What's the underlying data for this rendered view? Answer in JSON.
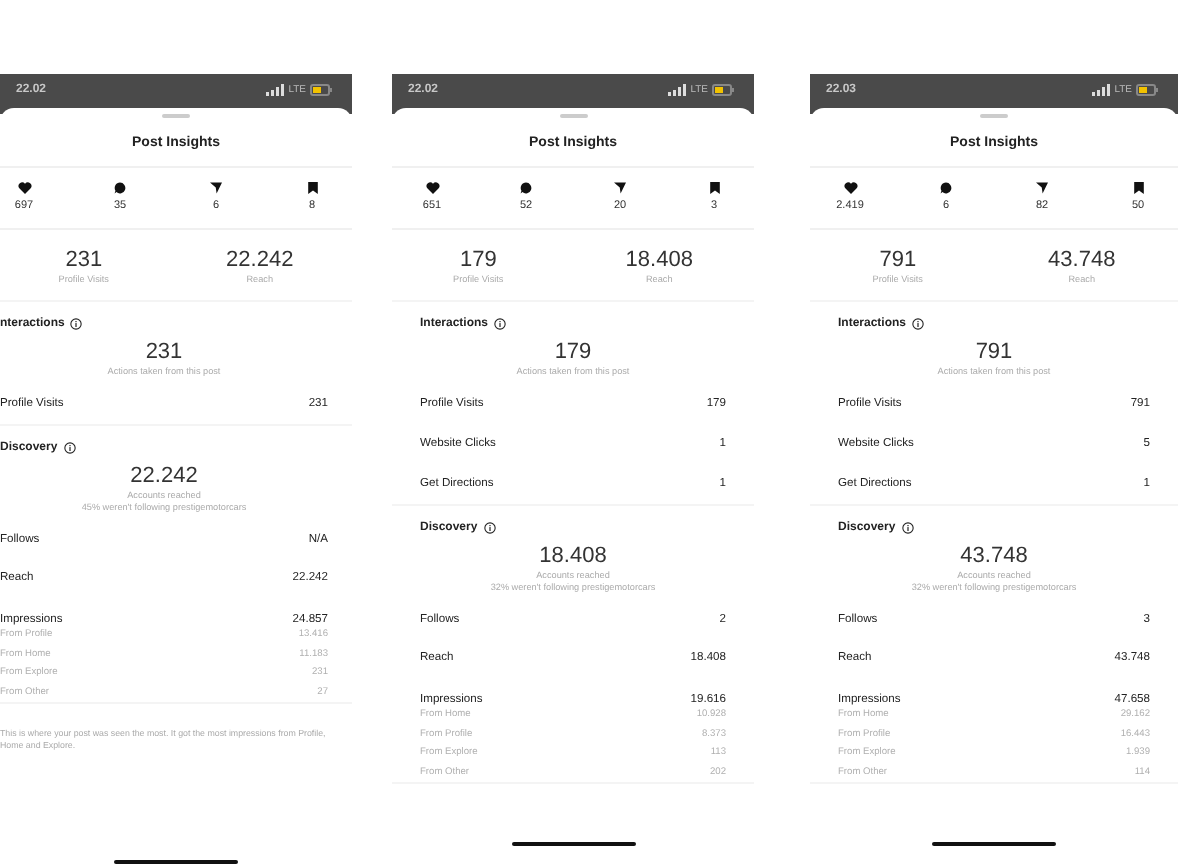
{
  "phones": [
    {
      "status": {
        "time": "22.02",
        "network": "LTE"
      },
      "title": "Post Insights",
      "stats": [
        {
          "kind": "likes",
          "value": "697"
        },
        {
          "kind": "comments",
          "value": "35"
        },
        {
          "kind": "shares",
          "value": "6"
        },
        {
          "kind": "saves",
          "value": "8"
        }
      ],
      "highlights": [
        {
          "value": "231",
          "label": "Profile Visits"
        },
        {
          "value": "22.242",
          "label": "Reach"
        }
      ],
      "interactions": {
        "heading": "nteractions",
        "total": "231",
        "caption": "Actions taken from this post",
        "rows": [
          {
            "label": "Profile Visits",
            "value": "231"
          }
        ]
      },
      "discovery": {
        "heading": "Discovery",
        "total": "22.242",
        "caption": "Accounts reached",
        "note": "45% weren't following prestigemotorcars",
        "rows": [
          {
            "kind": "main",
            "label": "Follows",
            "value": "N/A"
          },
          {
            "kind": "main",
            "label": "Reach",
            "value": "22.242"
          },
          {
            "kind": "main",
            "label": "Impressions",
            "value": "24.857"
          },
          {
            "kind": "sub",
            "label": "From Profile",
            "value": "13.416"
          },
          {
            "kind": "sub",
            "label": "From Home",
            "value": "11.183"
          },
          {
            "kind": "sub",
            "label": "From Explore",
            "value": "231"
          },
          {
            "kind": "sub",
            "label": "From Other",
            "value": "27"
          }
        ]
      },
      "footer": "This is where your post was seen the most. It got the most impressions from Profile, Home and Explore."
    },
    {
      "status": {
        "time": "22.02",
        "network": "LTE"
      },
      "title": "Post Insights",
      "stats": [
        {
          "kind": "likes",
          "value": "651"
        },
        {
          "kind": "comments",
          "value": "52"
        },
        {
          "kind": "shares",
          "value": "20"
        },
        {
          "kind": "saves",
          "value": "3"
        }
      ],
      "highlights": [
        {
          "value": "179",
          "label": "Profile Visits"
        },
        {
          "value": "18.408",
          "label": "Reach"
        }
      ],
      "interactions": {
        "heading": "Interactions",
        "total": "179",
        "caption": "Actions taken from this post",
        "rows": [
          {
            "label": "Profile Visits",
            "value": "179"
          },
          {
            "label": "Website Clicks",
            "value": "1"
          },
          {
            "label": "Get Directions",
            "value": "1"
          }
        ]
      },
      "discovery": {
        "heading": "Discovery",
        "total": "18.408",
        "caption": "Accounts reached",
        "note": "32% weren't following prestigemotorcars",
        "rows": [
          {
            "kind": "main",
            "label": "Follows",
            "value": "2"
          },
          {
            "kind": "main",
            "label": "Reach",
            "value": "18.408"
          },
          {
            "kind": "main",
            "label": "Impressions",
            "value": "19.616"
          },
          {
            "kind": "sub",
            "label": "From Home",
            "value": "10.928"
          },
          {
            "kind": "sub",
            "label": "From Profile",
            "value": "8.373"
          },
          {
            "kind": "sub",
            "label": "From Explore",
            "value": "113"
          },
          {
            "kind": "sub",
            "label": "From Other",
            "value": "202"
          }
        ]
      }
    },
    {
      "status": {
        "time": "22.03",
        "network": "LTE"
      },
      "title": "Post Insights",
      "stats": [
        {
          "kind": "likes",
          "value": "2.419"
        },
        {
          "kind": "comments",
          "value": "6"
        },
        {
          "kind": "shares",
          "value": "82"
        },
        {
          "kind": "saves",
          "value": "50"
        }
      ],
      "highlights": [
        {
          "value": "791",
          "label": "Profile Visits"
        },
        {
          "value": "43.748",
          "label": "Reach"
        }
      ],
      "interactions": {
        "heading": "Interactions",
        "total": "791",
        "caption": "Actions taken from this post",
        "rows": [
          {
            "label": "Profile Visits",
            "value": "791"
          },
          {
            "label": "Website Clicks",
            "value": "5"
          },
          {
            "label": "Get Directions",
            "value": "1"
          }
        ]
      },
      "discovery": {
        "heading": "Discovery",
        "total": "43.748",
        "caption": "Accounts reached",
        "note": "32% weren't following prestigemotorcars",
        "rows": [
          {
            "kind": "main",
            "label": "Follows",
            "value": "3"
          },
          {
            "kind": "main",
            "label": "Reach",
            "value": "43.748"
          },
          {
            "kind": "main",
            "label": "Impressions",
            "value": "47.658"
          },
          {
            "kind": "sub",
            "label": "From Home",
            "value": "29.162"
          },
          {
            "kind": "sub",
            "label": "From Profile",
            "value": "16.443"
          },
          {
            "kind": "sub",
            "label": "From Explore",
            "value": "1.939"
          },
          {
            "kind": "sub",
            "label": "From Other",
            "value": "114"
          }
        ]
      }
    }
  ]
}
